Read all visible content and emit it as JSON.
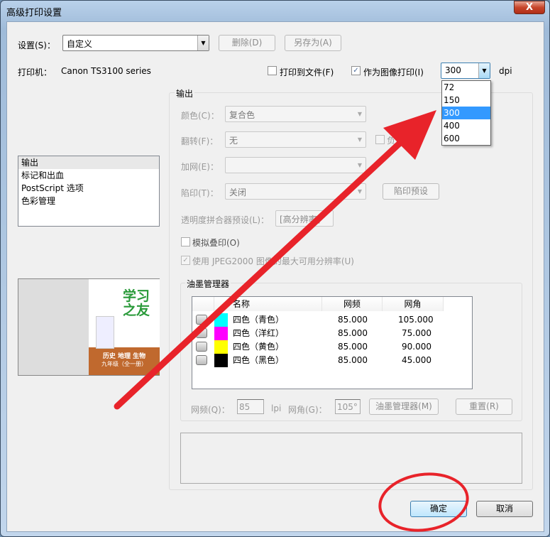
{
  "window": {
    "title": "高级打印设置",
    "close_label": "X"
  },
  "top": {
    "settings_label": "设置(S)：",
    "settings_value": "自定义",
    "delete_label": "删除(D)",
    "save_as_label": "另存为(A)",
    "printer_label": "打印机：",
    "printer_value": "Canon TS3100 series",
    "print_to_file_label": "打印到文件(F)",
    "print_to_file_checked": false,
    "print_as_image_label": "作为图像打印(I)",
    "print_as_image_checked": true,
    "dpi_value": "300",
    "dpi_unit": "dpi",
    "dpi_options": [
      "72",
      "150",
      "300",
      "400",
      "600"
    ],
    "dpi_selected": "300"
  },
  "sidebar": {
    "items": [
      "输出",
      "标记和出血",
      "PostScript 选项",
      "色彩管理"
    ],
    "selected": "输出"
  },
  "preview": {
    "cover_title": "学习之友",
    "cover_subject": "历史 地理 生物",
    "cover_grade": "九年级（全一册）"
  },
  "output": {
    "group_label": "输出",
    "color_label": "颜色(C)：",
    "color_value": "复合色",
    "flip_label": "翻转(F)：",
    "flip_value": "无",
    "negative_label": "负片",
    "screen_label": "加网(E)：",
    "screen_value": "",
    "trap_label": "陷印(T)：",
    "trap_value": "关闭",
    "trap_preset_label": "陷印预设",
    "flattener_label": "透明度拼合器预设(L)：",
    "flattener_value": "[高分辨率]",
    "overprint_label": "模拟叠印(O)",
    "jpeg2000_label": "使用 JPEG2000 图像的最大可用分辨率(U)"
  },
  "ink": {
    "group_label": "油墨管理器",
    "columns": [
      "名称",
      "网频",
      "网角"
    ],
    "rows": [
      {
        "name": "四色（青色）",
        "freq": "85.000",
        "angle": "105.000",
        "color": "#00ffff"
      },
      {
        "name": "四色（洋红）",
        "freq": "85.000",
        "angle": "75.000",
        "color": "#ff00ff"
      },
      {
        "name": "四色（黄色）",
        "freq": "85.000",
        "angle": "90.000",
        "color": "#ffff00"
      },
      {
        "name": "四色（黑色）",
        "freq": "85.000",
        "angle": "45.000",
        "color": "#000000"
      }
    ],
    "freq_label": "网频(Q)：",
    "freq_value": "85",
    "lpi": "lpi",
    "angle_label": "网角(G)：",
    "angle_value": "105°",
    "ink_manager_button": "油墨管理器(M)",
    "reset_button": "重置(R)"
  },
  "footer": {
    "ok_label": "确定",
    "cancel_label": "取消"
  },
  "annotation_color": "#e8232a"
}
